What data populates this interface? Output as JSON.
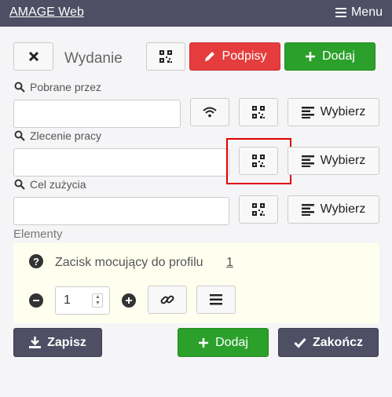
{
  "topbar": {
    "brand": "AMAGE Web",
    "menu_label": "Menu"
  },
  "header": {
    "title": "Wydanie",
    "signatures_label": "Podpisy",
    "add_label": "Dodaj"
  },
  "fields": {
    "collected_by": {
      "label": "Pobrane przez",
      "value": "",
      "select_label": "Wybierz"
    },
    "work_order": {
      "label": "Zlecenie pracy",
      "value": "",
      "select_label": "Wybierz"
    },
    "purpose": {
      "label": "Cel zużycia",
      "value": "",
      "select_label": "Wybierz"
    }
  },
  "elements": {
    "label": "Elementy",
    "items": [
      {
        "name": "Zacisk mocujący do profilu",
        "count": "1",
        "quantity": "1"
      }
    ]
  },
  "footer": {
    "save_label": "Zapisz",
    "add_label": "Dodaj",
    "finish_label": "Zakończ"
  },
  "colors": {
    "topbar": "#4e4e64",
    "red": "#e53d3d",
    "green": "#2ba02b",
    "highlight": "#e00000"
  }
}
